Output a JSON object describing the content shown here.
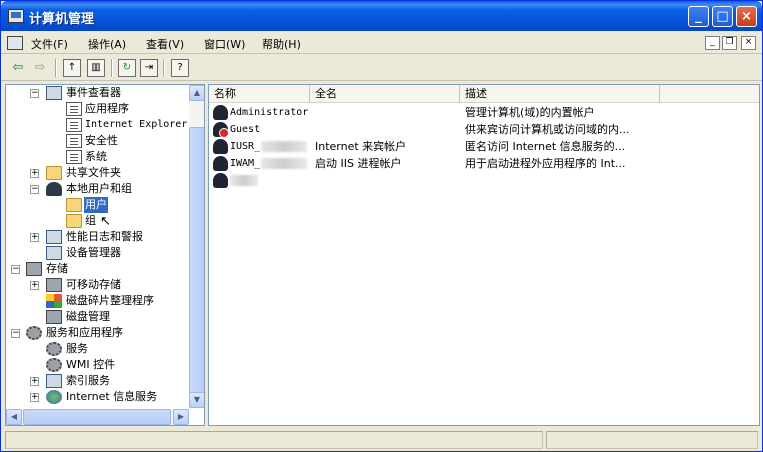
{
  "window": {
    "title": "计算机管理"
  },
  "menu": [
    "文件(F)",
    "操作(A)",
    "查看(V)",
    "窗口(W)",
    "帮助(H)"
  ],
  "tree": {
    "items": [
      {
        "label": "事件查看器"
      },
      {
        "label": "应用程序"
      },
      {
        "label": "Internet Explorer"
      },
      {
        "label": "安全性"
      },
      {
        "label": "系统"
      },
      {
        "label": "共享文件夹"
      },
      {
        "label": "本地用户和组"
      },
      {
        "label": "用户"
      },
      {
        "label": "组"
      },
      {
        "label": "性能日志和警报"
      },
      {
        "label": "设备管理器"
      },
      {
        "label": "存储"
      },
      {
        "label": "可移动存储"
      },
      {
        "label": "磁盘碎片整理程序"
      },
      {
        "label": "磁盘管理"
      },
      {
        "label": "服务和应用程序"
      },
      {
        "label": "服务"
      },
      {
        "label": "WMI 控件"
      },
      {
        "label": "索引服务"
      },
      {
        "label": "Internet 信息服务"
      }
    ]
  },
  "list": {
    "columns": [
      "名称",
      "全名",
      "描述"
    ],
    "rows": [
      {
        "name": "Administrator",
        "fullname": "",
        "desc": "管理计算机(域)的内置帐户"
      },
      {
        "name": "Guest",
        "fullname": "",
        "desc": "供来宾访问计算机或访问域的内..."
      },
      {
        "name": "IUSR_",
        "fullname": "Internet 来宾帐户",
        "desc": "匿名访问 Internet 信息服务的..."
      },
      {
        "name": "IWAM_",
        "fullname": "启动 IIS 进程帐户",
        "desc": "用于启动进程外应用程序的 Int..."
      },
      {
        "name": "",
        "fullname": "",
        "desc": ""
      }
    ]
  }
}
